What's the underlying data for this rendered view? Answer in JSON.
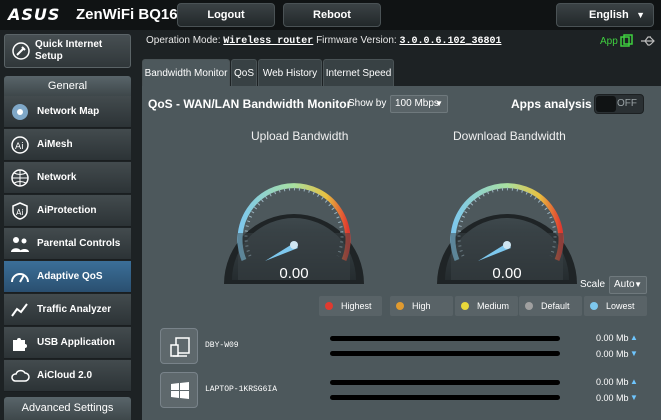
{
  "header": {
    "logo": "ASUS",
    "product": "ZenWiFi BQ16",
    "logout_label": "Logout",
    "reboot_label": "Reboot",
    "language": "English"
  },
  "status": {
    "op_mode_label": "Operation Mode:",
    "op_mode": "Wireless router",
    "fw_label": "Firmware Version:",
    "fw_version": "3.0.0.6.102_36801",
    "app_label": "App"
  },
  "sidebar": {
    "quick_setup": "Quick Internet Setup",
    "general_header": "General",
    "items": [
      {
        "label": "Network Map",
        "icon": "network-map-icon"
      },
      {
        "label": "AiMesh",
        "icon": "aimesh-icon"
      },
      {
        "label": "Network",
        "icon": "globe-icon"
      },
      {
        "label": "AiProtection",
        "icon": "shield-icon"
      },
      {
        "label": "Parental Controls",
        "icon": "family-icon"
      },
      {
        "label": "Adaptive QoS",
        "icon": "speedometer-icon"
      },
      {
        "label": "Traffic Analyzer",
        "icon": "traffic-icon"
      },
      {
        "label": "USB Application",
        "icon": "puzzle-icon"
      },
      {
        "label": "AiCloud 2.0",
        "icon": "cloud-icon"
      }
    ],
    "active_index": 5,
    "advanced_header": "Advanced Settings"
  },
  "tabs": [
    {
      "label": "Bandwidth Monitor",
      "active": true
    },
    {
      "label": "QoS",
      "active": false
    },
    {
      "label": "Web History",
      "active": false
    },
    {
      "label": "Internet Speed",
      "active": false
    }
  ],
  "panel": {
    "title": "QoS - WAN/LAN Bandwidth Monitor",
    "show_by_label": "Show by",
    "show_by_value": "100 Mbps",
    "apps_analysis_label": "Apps analysis",
    "apps_analysis_state": "OFF",
    "upload_title": "Upload Bandwidth",
    "upload_value": "0.00",
    "download_title": "Download Bandwidth",
    "download_value": "0.00",
    "scale_label": "Scale",
    "scale_value": "Auto"
  },
  "legend": [
    {
      "label": "Highest",
      "color": "#e03a2f"
    },
    {
      "label": "High",
      "color": "#e09a2f"
    },
    {
      "label": "Medium",
      "color": "#e8d83a"
    },
    {
      "label": "Default",
      "color": "#a0a0a0"
    },
    {
      "label": "Lowest",
      "color": "#7ec8ee"
    }
  ],
  "clients": [
    {
      "name": "DBY-W09",
      "upload": "0.00 Mb",
      "download": "0.00 Mb",
      "icon": "device-icon"
    },
    {
      "name": "LAPTOP-1KRSG6IA",
      "upload": "0.00 Mb",
      "download": "0.00 Mb",
      "icon": "windows-icon"
    }
  ],
  "colors": {
    "accent_blue": "#3b6f98",
    "app_green": "#3fcf3f"
  }
}
